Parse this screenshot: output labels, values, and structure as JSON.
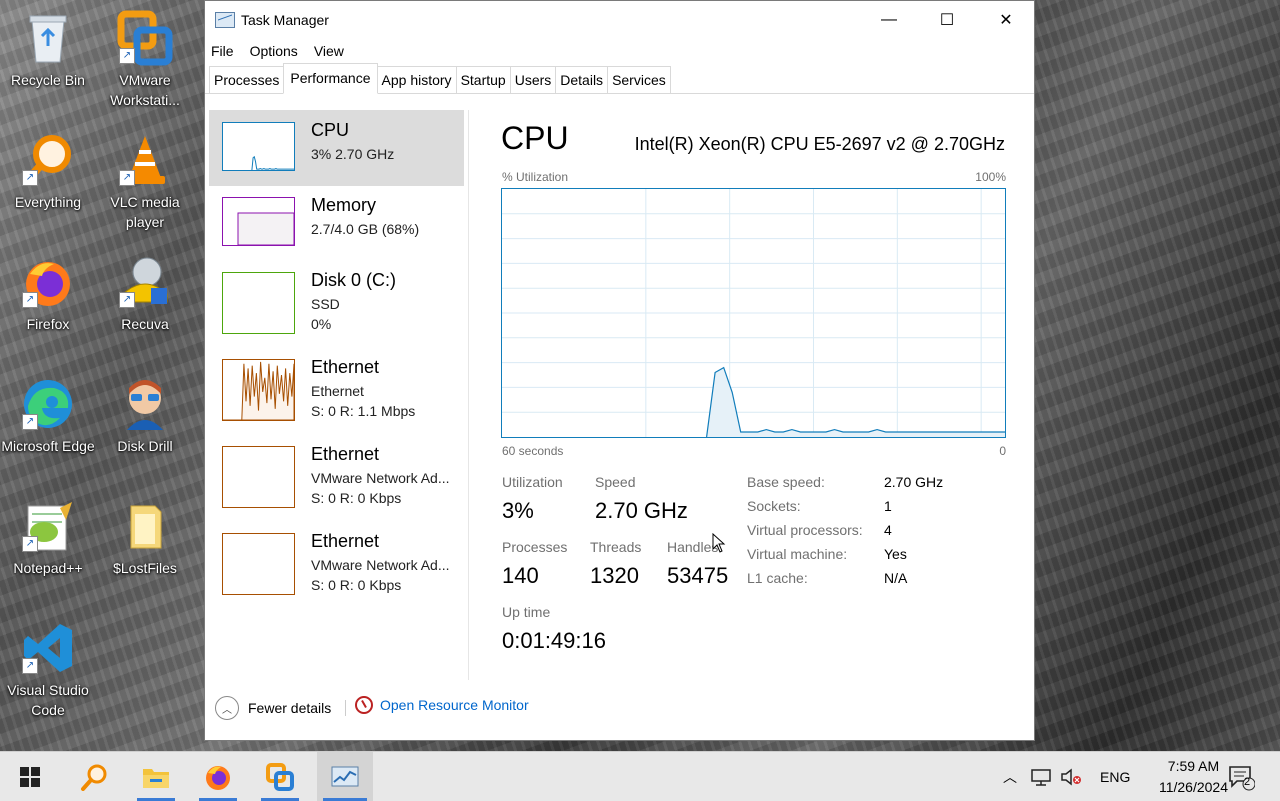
{
  "desktop": {
    "icons": [
      {
        "label": "Recycle Bin"
      },
      {
        "label": "VMware Workstati..."
      },
      {
        "label": "Everything"
      },
      {
        "label": "VLC media player"
      },
      {
        "label": "Firefox"
      },
      {
        "label": "Recuva"
      },
      {
        "label": "Microsoft Edge"
      },
      {
        "label": "Disk Drill"
      },
      {
        "label": "Notepad++"
      },
      {
        "label": "$LostFiles"
      },
      {
        "label": "Visual Studio Code"
      }
    ]
  },
  "window": {
    "title": "Task Manager",
    "controls": {
      "minimize": "—",
      "maximize": "☐",
      "close": "✕"
    },
    "menu": [
      "File",
      "Options",
      "View"
    ],
    "tabs": [
      "Processes",
      "Performance",
      "App history",
      "Startup",
      "Users",
      "Details",
      "Services"
    ],
    "active_tab": "Performance"
  },
  "resources": [
    {
      "name": "CPU",
      "line1": "3% 2.70 GHz",
      "line2": "",
      "color": "#117dbb",
      "fill": "#f1f6fa"
    },
    {
      "name": "Memory",
      "line1": "2.7/4.0 GB (68%)",
      "line2": "",
      "color": "#8b12ae",
      "fill": "#f4f2f4"
    },
    {
      "name": "Disk 0 (C:)",
      "line1": "SSD",
      "line2": "0%",
      "color": "#4da60c",
      "fill": "#eff7ea"
    },
    {
      "name": "Ethernet",
      "line1": "Ethernet",
      "line2": "S: 0 R: 1.1 Mbps",
      "color": "#a74f01",
      "fill": "#fcf3eb"
    },
    {
      "name": "Ethernet",
      "line1": "VMware Network Ad...",
      "line2": "S: 0 R: 0 Kbps",
      "color": "#a74f01",
      "fill": "#fcf3eb"
    },
    {
      "name": "Ethernet",
      "line1": "VMware Network Ad...",
      "line2": "S: 0 R: 0 Kbps",
      "color": "#a74f01",
      "fill": "#fcf3eb"
    }
  ],
  "cpu_panel": {
    "title": "CPU",
    "model": "Intel(R) Xeon(R) CPU E5-2697 v2 @ 2.70GHz",
    "util_label": "% Utilization",
    "max_label": "100%",
    "time_label": "60 seconds",
    "min_label": "0",
    "utilization_history_pct": [
      0,
      0,
      0,
      0,
      0,
      0,
      0,
      0,
      0,
      0,
      0,
      0,
      0,
      0,
      0,
      0,
      0,
      0,
      0,
      0,
      0,
      0,
      0,
      0,
      0,
      26,
      28,
      18,
      2,
      2,
      2,
      3,
      2,
      2,
      3,
      2,
      2,
      2,
      2,
      3,
      2,
      2,
      2,
      2,
      3,
      2,
      2,
      2,
      2,
      2,
      2,
      2,
      2,
      2,
      2,
      2,
      2,
      2,
      2,
      2
    ],
    "stats": {
      "utilization": {
        "label": "Utilization",
        "value": "3%"
      },
      "speed": {
        "label": "Speed",
        "value": "2.70 GHz"
      },
      "processes": {
        "label": "Processes",
        "value": "140"
      },
      "threads": {
        "label": "Threads",
        "value": "1320"
      },
      "handles": {
        "label": "Handles",
        "value": "53475"
      },
      "uptime": {
        "label": "Up time",
        "value": "0:01:49:16"
      }
    },
    "details": [
      {
        "key": "Base speed:",
        "value": "2.70 GHz"
      },
      {
        "key": "Sockets:",
        "value": "1"
      },
      {
        "key": "Virtual processors:",
        "value": "4"
      },
      {
        "key": "Virtual machine:",
        "value": "Yes"
      },
      {
        "key": "L1 cache:",
        "value": "N/A"
      }
    ]
  },
  "footer": {
    "fewer_details": "Fewer details",
    "resource_monitor": "Open Resource Monitor"
  },
  "taskbar": {
    "language": "ENG",
    "time": "7:59 AM",
    "date": "11/26/2024",
    "notification_count": "2"
  }
}
